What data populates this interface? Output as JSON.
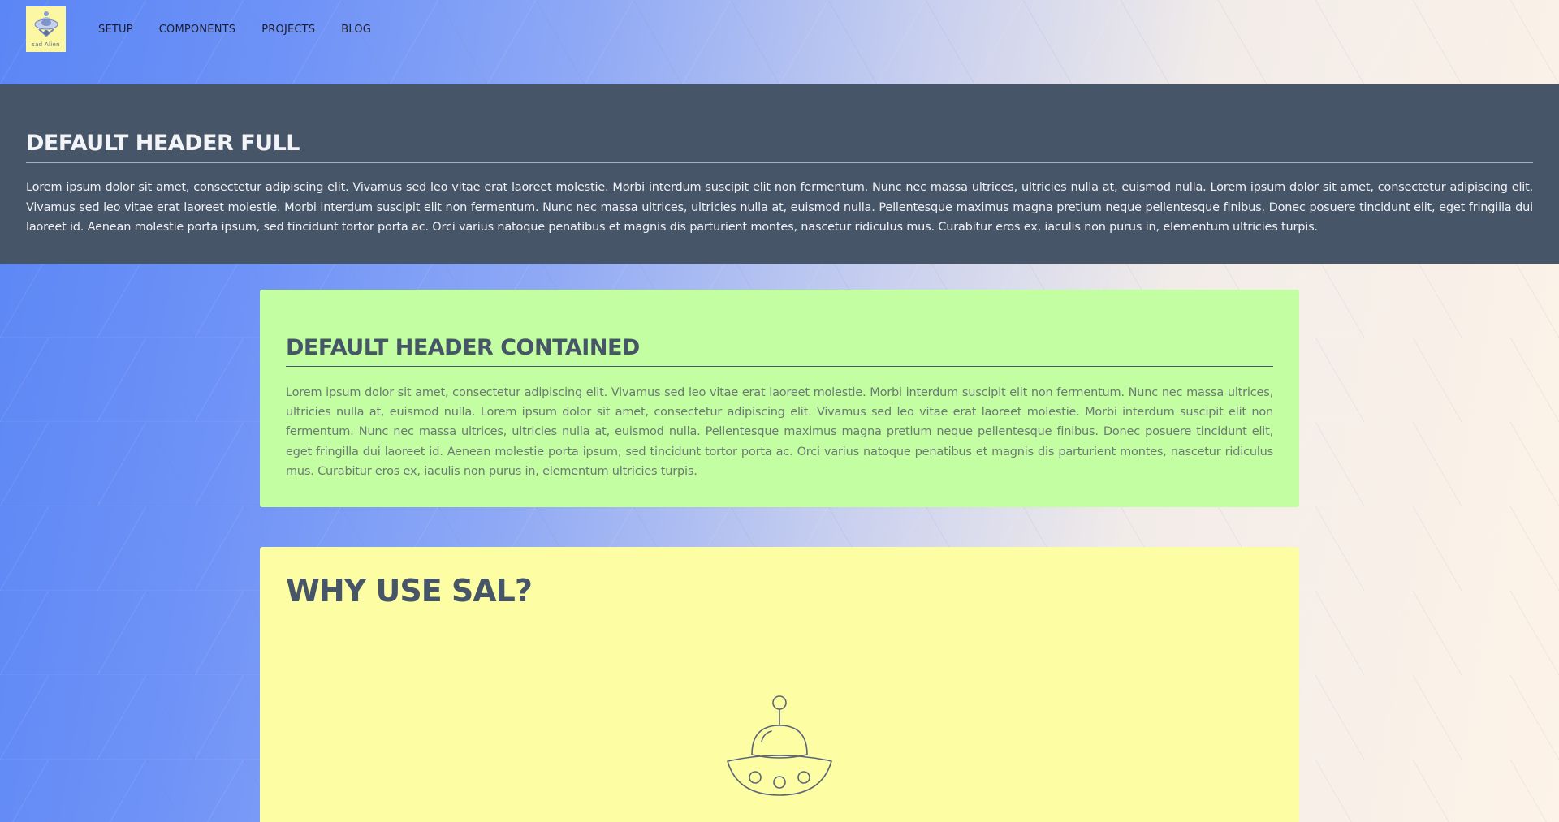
{
  "logo": {
    "text": "sad Alien"
  },
  "nav": {
    "items": [
      {
        "label": "SETUP"
      },
      {
        "label": "COMPONENTS"
      },
      {
        "label": "PROJECTS"
      },
      {
        "label": "BLOG"
      }
    ]
  },
  "full_header": {
    "title": "DEFAULT HEADER FULL",
    "body": "Lorem ipsum dolor sit amet, consectetur adipiscing elit. Vivamus sed leo vitae erat laoreet molestie. Morbi interdum suscipit elit non fermentum. Nunc nec massa ultrices, ultricies nulla at, euismod nulla. Lorem ipsum dolor sit amet, consectetur adipiscing elit. Vivamus sed leo vitae erat laoreet molestie. Morbi interdum suscipit elit non fermentum. Nunc nec massa ultrices, ultricies nulla at, euismod nulla. Pellentesque maximus magna pretium neque pellentesque finibus. Donec posuere tincidunt elit, eget fringilla dui laoreet id. Aenean molestie porta ipsum, sed tincidunt tortor porta ac. Orci varius natoque penatibus et magnis dis parturient montes, nascetur ridiculus mus. Curabitur eros ex, iaculis non purus in, elementum ultricies turpis."
  },
  "contained_header": {
    "title": "DEFAULT HEADER CONTAINED",
    "body": "Lorem ipsum dolor sit amet, consectetur adipiscing elit. Vivamus sed leo vitae erat laoreet molestie. Morbi interdum suscipit elit non fermentum. Nunc nec massa ultrices, ultricies nulla at, euismod nulla. Lorem ipsum dolor sit amet, consectetur adipiscing elit. Vivamus sed leo vitae erat laoreet molestie. Morbi interdum suscipit elit non fermentum. Nunc nec massa ultrices, ultricies nulla at, euismod nulla. Pellentesque maximus magna pretium neque pellentesque finibus. Donec posuere tincidunt elit, eget fringilla dui laoreet id. Aenean molestie porta ipsum, sed tincidunt tortor porta ac. Orci varius natoque penatibus et magnis dis parturient montes, nascetur ridiculus mus. Curabitur eros ex, iaculis non purus in, elementum ultricies turpis."
  },
  "why_section": {
    "title": "WHY USE SAL?",
    "icon": "ufo-icon"
  },
  "colors": {
    "full_header_bg": "#465568",
    "contained_bg": "#c4fea3",
    "why_bg": "#fdfea3",
    "logo_bg": "#fbf7a3",
    "gradient_start": "#5b86f5",
    "gradient_end": "#fdf3e8"
  }
}
